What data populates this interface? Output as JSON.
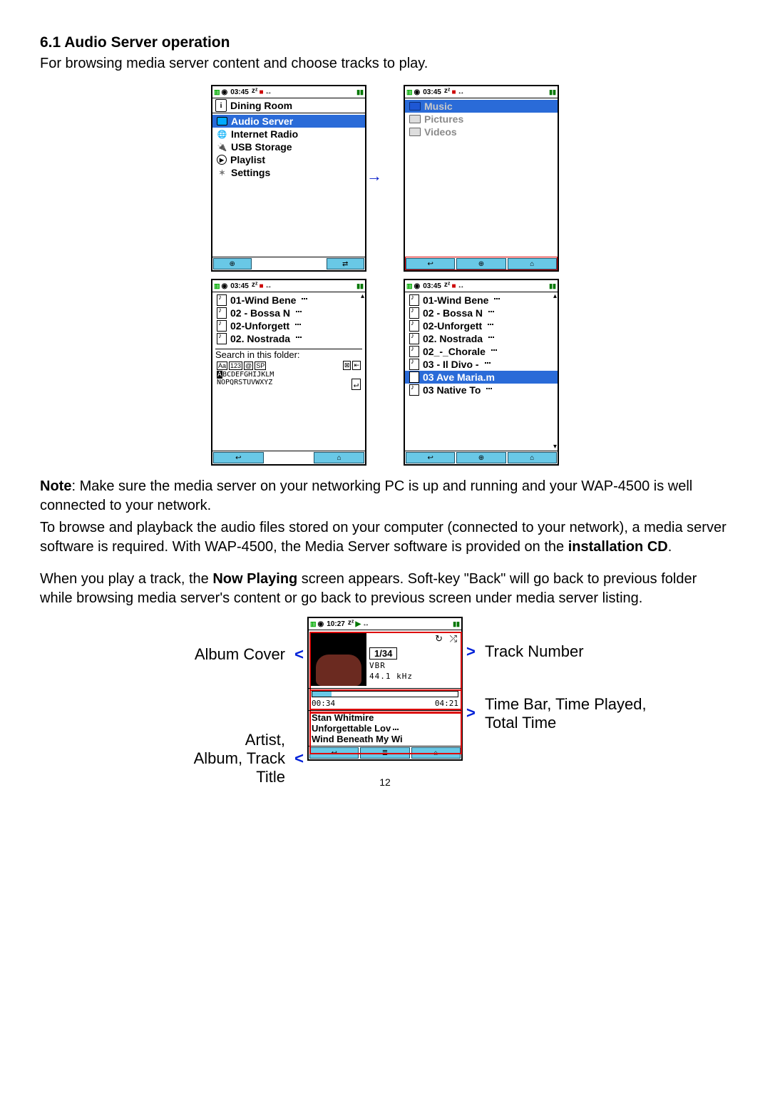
{
  "heading": "6.1  Audio Server operation",
  "intro": "For browsing media server content and choose tracks to play.",
  "note": {
    "label": "Note",
    "text_1": ": Make sure the media server on your networking PC is up and running and your WAP-4500 is well connected to your network.",
    "text_2a": "To browse and playback the audio files stored on your computer (connected to your network), a media server software is required. With WAP-4500, the Media Server software is provided on the ",
    "text_2b": "installation CD",
    "text_2c": "."
  },
  "para2_a": "When you play a track, the ",
  "para2_b": "Now Playing",
  "para2_c": " screen appears. Soft-key \"Back\" will go back to previous folder while browsing media server's content or go back to previous screen under media server listing.",
  "status": {
    "time_a": "03:45",
    "time_b": "10:27",
    "sleep": "zᶻ",
    "arrows": "↔"
  },
  "screen1": {
    "title": "Dining Room",
    "items": [
      "Audio Server",
      "Internet Radio",
      "USB Storage",
      "Playlist",
      "Settings"
    ]
  },
  "screen2": {
    "items": [
      "Music",
      "Pictures",
      "Videos"
    ]
  },
  "screen3": {
    "items": [
      "01-Wind Bene",
      "02 - Bossa N",
      "02-Unforgett",
      "02. Nostrada"
    ],
    "search_label": "Search in this folder:",
    "kb1": "ABCDEFGHIJKLM",
    "kb2": "NOPQRSTUVWXYZ",
    "kbtabs": [
      "Aa",
      "123",
      "@",
      "SP"
    ]
  },
  "screen4": {
    "items": [
      "01-Wind Bene",
      "02 - Bossa N",
      "02-Unforgett",
      "02. Nostrada",
      "02_-_Chorale",
      "03 - Il Divo -",
      "03 Ave Maria.m",
      "03 Native To"
    ]
  },
  "now_playing": {
    "track_num": "1/34",
    "vbr": "VBR",
    "khz": "44.1 kHz",
    "played": "00:34",
    "total": "04:21",
    "artist": "Stan Whitmire",
    "album": "Unforgettable Lov",
    "title": "Wind Beneath My Wi"
  },
  "callouts": {
    "album_cover": "Album Cover",
    "artist_block": "Artist,\nAlbum, Track\nTitle",
    "track_number": "Track Number",
    "time_block": "Time Bar, Time Played,\nTotal Time"
  },
  "pagenum": "12"
}
